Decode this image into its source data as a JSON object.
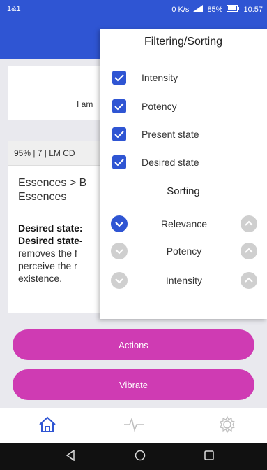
{
  "status": {
    "left": "1&1",
    "right": [
      "0 K/s",
      "85%",
      "10:57"
    ]
  },
  "card_top": {
    "partial_text": "I am"
  },
  "card_info": {
    "header": "95% | 7 | LM CD",
    "path_line1": "Essences > B",
    "path_line2": "Essences",
    "desc_bold1": "Desired state:",
    "desc_bold2": "Desired state-",
    "desc_line3": "removes the f",
    "desc_line4": "perceive the r",
    "desc_line5": "existence."
  },
  "buttons": {
    "actions": "Actions",
    "vibrate": "Vibrate"
  },
  "panel": {
    "title": "Filtering/Sorting",
    "filters": [
      {
        "label": "Intensity",
        "checked": true
      },
      {
        "label": "Potency",
        "checked": true
      },
      {
        "label": "Present state",
        "checked": true
      },
      {
        "label": "Desired state",
        "checked": true
      }
    ],
    "sorting_title": "Sorting",
    "sort_items": [
      {
        "label": "Relevance",
        "selected": true
      },
      {
        "label": "Potency",
        "selected": false
      },
      {
        "label": "Intensity",
        "selected": false
      }
    ]
  },
  "tabs": {
    "icons": [
      "home-icon",
      "pulse-icon",
      "settings-icon"
    ]
  },
  "colors": {
    "primary": "#2f55d3",
    "accent": "#cf3bb3"
  }
}
